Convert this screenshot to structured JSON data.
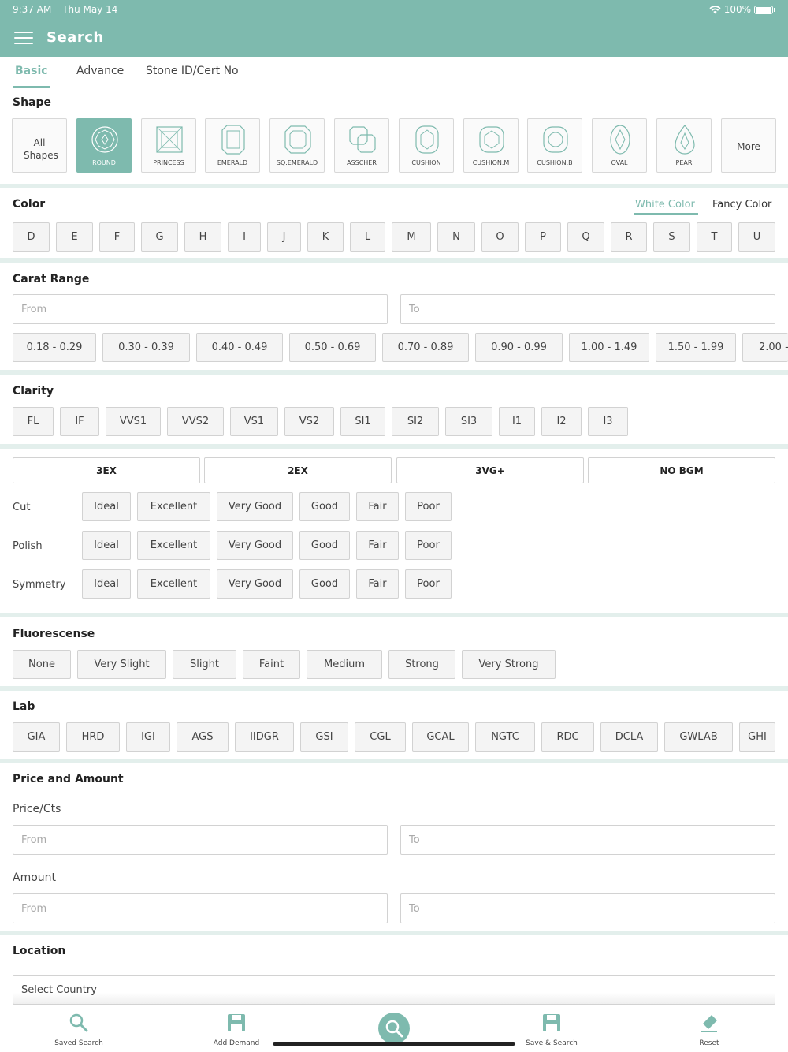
{
  "status": {
    "time": "9:37 AM",
    "date": "Thu May 14",
    "battery": "100%"
  },
  "header": {
    "title": "Search"
  },
  "tabs": [
    {
      "label": "Basic",
      "active": true
    },
    {
      "label": "Advance"
    },
    {
      "label": "Stone ID/Cert No"
    }
  ],
  "shape": {
    "title": "Shape",
    "all_label": "All Shapes",
    "more_label": "More",
    "items": [
      {
        "label": "ROUND",
        "icon": "round-diamond-icon",
        "active": true
      },
      {
        "label": "PRINCESS",
        "icon": "princess-diamond-icon"
      },
      {
        "label": "EMERALD",
        "icon": "emerald-diamond-icon"
      },
      {
        "label": "SQ.EMERALD",
        "icon": "sq-emerald-diamond-icon"
      },
      {
        "label": "ASSCHER",
        "icon": "asscher-diamond-icon"
      },
      {
        "label": "CUSHION",
        "icon": "cushion-diamond-icon"
      },
      {
        "label": "CUSHION.M",
        "icon": "cushion-m-diamond-icon"
      },
      {
        "label": "CUSHION.B",
        "icon": "cushion-b-diamond-icon"
      },
      {
        "label": "OVAL",
        "icon": "oval-diamond-icon"
      },
      {
        "label": "PEAR",
        "icon": "pear-diamond-icon"
      }
    ]
  },
  "color": {
    "title": "Color",
    "tabs": [
      {
        "label": "White Color",
        "active": true
      },
      {
        "label": "Fancy Color"
      }
    ],
    "items": [
      "D",
      "E",
      "F",
      "G",
      "H",
      "I",
      "J",
      "K",
      "L",
      "M",
      "N",
      "O",
      "P",
      "Q",
      "R",
      "S",
      "T",
      "U"
    ]
  },
  "carat": {
    "title": "Carat Range",
    "from_placeholder": "From",
    "to_placeholder": "To",
    "ranges": [
      "0.18 - 0.29",
      "0.30 - 0.39",
      "0.40 - 0.49",
      "0.50 - 0.69",
      "0.70 - 0.89",
      "0.90 - 0.99",
      "1.00 - 1.49",
      "1.50 - 1.99",
      "2.00 -"
    ]
  },
  "clarity": {
    "title": "Clarity",
    "items": [
      "FL",
      "IF",
      "VVS1",
      "VVS2",
      "VS1",
      "VS2",
      "SI1",
      "SI2",
      "SI3",
      "I1",
      "I2",
      "I3"
    ]
  },
  "finish": {
    "presets": [
      "3EX",
      "2EX",
      "3VG+",
      "NO BGM"
    ],
    "rows": [
      {
        "label": "Cut",
        "options": [
          "Ideal",
          "Excellent",
          "Very Good",
          "Good",
          "Fair",
          "Poor"
        ]
      },
      {
        "label": "Polish",
        "options": [
          "Ideal",
          "Excellent",
          "Very Good",
          "Good",
          "Fair",
          "Poor"
        ]
      },
      {
        "label": "Symmetry",
        "options": [
          "Ideal",
          "Excellent",
          "Very Good",
          "Good",
          "Fair",
          "Poor"
        ]
      }
    ]
  },
  "fluorescence": {
    "title": "Fluorescense",
    "items": [
      "None",
      "Very Slight",
      "Slight",
      "Faint",
      "Medium",
      "Strong",
      "Very Strong"
    ]
  },
  "lab": {
    "title": "Lab",
    "items": [
      "GIA",
      "HRD",
      "IGI",
      "AGS",
      "IIDGR",
      "GSI",
      "CGL",
      "GCAL",
      "NGTC",
      "RDC",
      "DCLA",
      "GWLAB",
      "GHI"
    ]
  },
  "price": {
    "title": "Price and Amount",
    "price_label": "Price/Cts",
    "amount_label": "Amount",
    "from_placeholder": "From",
    "to_placeholder": "To"
  },
  "location": {
    "title": "Location",
    "placeholder": "Select Country"
  },
  "bottom_nav": [
    {
      "label": "Saved Search",
      "icon": "saved-search-icon"
    },
    {
      "label": "Add Demand",
      "icon": "add-demand-icon"
    },
    {
      "label": "",
      "icon": "search-icon"
    },
    {
      "label": "Save & Search",
      "icon": "save-search-icon"
    },
    {
      "label": "Reset",
      "icon": "reset-eraser-icon"
    }
  ],
  "colors": {
    "accent": "#7ebaae",
    "divider": "#e3efec"
  }
}
